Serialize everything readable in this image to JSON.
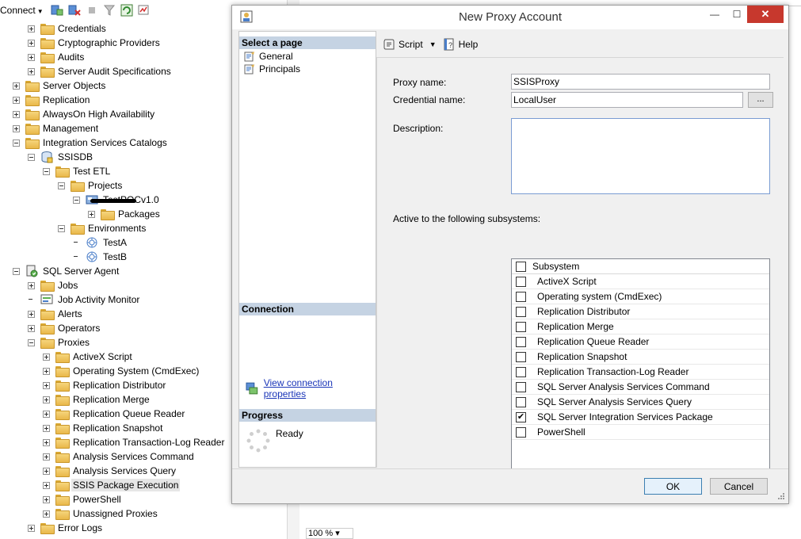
{
  "explorer": {
    "connect_label": "Connect",
    "tree": [
      {
        "label": "Credentials",
        "indent": 1,
        "exp": "plus"
      },
      {
        "label": "Cryptographic Providers",
        "indent": 1,
        "exp": "plus"
      },
      {
        "label": "Audits",
        "indent": 1,
        "exp": "plus"
      },
      {
        "label": "Server Audit Specifications",
        "indent": 1,
        "exp": "plus"
      },
      {
        "label": "Server Objects",
        "indent": 0,
        "exp": "plus"
      },
      {
        "label": "Replication",
        "indent": 0,
        "exp": "plus"
      },
      {
        "label": "AlwaysOn High Availability",
        "indent": 0,
        "exp": "plus"
      },
      {
        "label": "Management",
        "indent": 0,
        "exp": "plus"
      },
      {
        "label": "Integration Services Catalogs",
        "indent": 0,
        "exp": "minus"
      },
      {
        "label": "SSISDB",
        "indent": 1,
        "exp": "minus",
        "icon": "database"
      },
      {
        "label": "Test ETL",
        "indent": 2,
        "exp": "minus"
      },
      {
        "label": "Projects",
        "indent": 3,
        "exp": "minus"
      },
      {
        "label": "TestPOCv1.0",
        "indent": 4,
        "exp": "minus",
        "icon": "project",
        "redacted": true
      },
      {
        "label": "Packages",
        "indent": 5,
        "exp": "plus"
      },
      {
        "label": "Environments",
        "indent": 3,
        "exp": "minus"
      },
      {
        "label": "TestA",
        "indent": 4,
        "exp": "none",
        "icon": "environment"
      },
      {
        "label": "TestB",
        "indent": 4,
        "exp": "none",
        "icon": "environment"
      },
      {
        "label": "SQL Server Agent",
        "indent": 0,
        "exp": "minus",
        "icon": "agent"
      },
      {
        "label": "Jobs",
        "indent": 1,
        "exp": "plus"
      },
      {
        "label": "Job Activity Monitor",
        "indent": 1,
        "exp": "none",
        "icon": "monitor"
      },
      {
        "label": "Alerts",
        "indent": 1,
        "exp": "plus"
      },
      {
        "label": "Operators",
        "indent": 1,
        "exp": "plus"
      },
      {
        "label": "Proxies",
        "indent": 1,
        "exp": "minus"
      },
      {
        "label": "ActiveX Script",
        "indent": 2,
        "exp": "plus"
      },
      {
        "label": "Operating System (CmdExec)",
        "indent": 2,
        "exp": "plus"
      },
      {
        "label": "Replication Distributor",
        "indent": 2,
        "exp": "plus"
      },
      {
        "label": "Replication Merge",
        "indent": 2,
        "exp": "plus"
      },
      {
        "label": "Replication Queue Reader",
        "indent": 2,
        "exp": "plus"
      },
      {
        "label": "Replication Snapshot",
        "indent": 2,
        "exp": "plus"
      },
      {
        "label": "Replication Transaction-Log Reader",
        "indent": 2,
        "exp": "plus"
      },
      {
        "label": "Analysis Services Command",
        "indent": 2,
        "exp": "plus"
      },
      {
        "label": "Analysis Services Query",
        "indent": 2,
        "exp": "plus"
      },
      {
        "label": "SSIS Package Execution",
        "indent": 2,
        "exp": "plus",
        "selected": true
      },
      {
        "label": "PowerShell",
        "indent": 2,
        "exp": "plus"
      },
      {
        "label": "Unassigned Proxies",
        "indent": 2,
        "exp": "plus"
      },
      {
        "label": "Error Logs",
        "indent": 1,
        "exp": "plus"
      }
    ],
    "zoom": "100 %"
  },
  "dialog": {
    "title": "New Proxy Account",
    "select_page_header": "Select a page",
    "pages": [
      "General",
      "Principals"
    ],
    "connection_header": "Connection",
    "view_connection_link": "View connection properties",
    "progress_header": "Progress",
    "progress_status": "Ready",
    "toolbar": {
      "script_label": "Script",
      "help_label": "Help"
    },
    "form": {
      "proxy_name_label": "Proxy name:",
      "proxy_name_value": "SSISProxy",
      "credential_name_label": "Credential name:",
      "credential_name_value": "LocalUser",
      "browse_label": "...",
      "description_label": "Description:",
      "description_value": "",
      "subsystems_label": "Active to the following subsystems:"
    },
    "subsystems_header": "Subsystem",
    "subsystems": [
      {
        "name": "ActiveX Script",
        "checked": false
      },
      {
        "name": "Operating system (CmdExec)",
        "checked": false
      },
      {
        "name": "Replication Distributor",
        "checked": false
      },
      {
        "name": "Replication Merge",
        "checked": false
      },
      {
        "name": "Replication Queue Reader",
        "checked": false
      },
      {
        "name": "Replication Snapshot",
        "checked": false
      },
      {
        "name": "Replication Transaction-Log Reader",
        "checked": false
      },
      {
        "name": "SQL Server Analysis Services Command",
        "checked": false
      },
      {
        "name": "SQL Server Analysis Services Query",
        "checked": false
      },
      {
        "name": "SQL Server Integration Services Package",
        "checked": true
      },
      {
        "name": "PowerShell",
        "checked": false
      }
    ],
    "ok_label": "OK",
    "cancel_label": "Cancel"
  }
}
